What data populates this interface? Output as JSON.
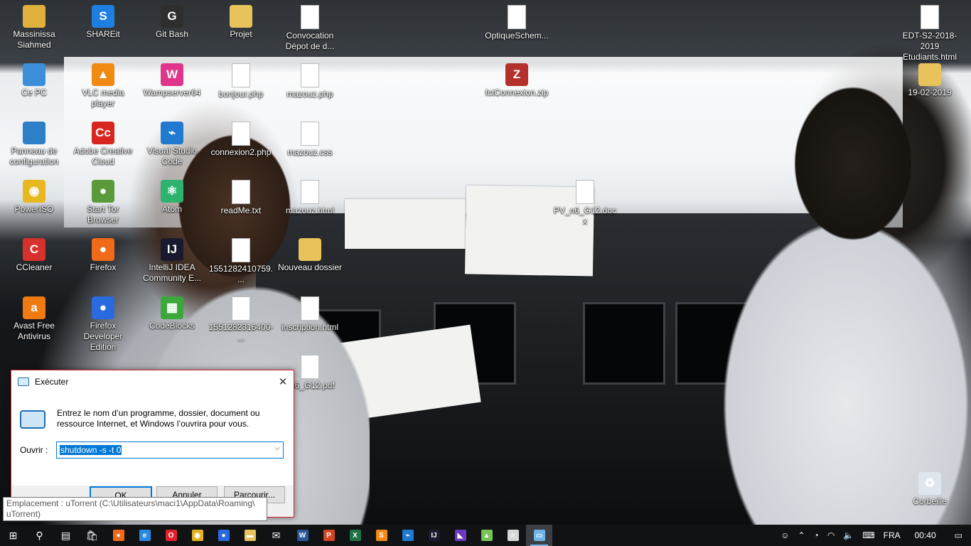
{
  "desktop_icons": [
    {
      "label": "Massinissa Siahmed",
      "col": 0,
      "row": 0,
      "icon": "user-folder-icon",
      "color": "#e0b03a",
      "glyph": "",
      "badge": "none"
    },
    {
      "label": "SHAREit",
      "col": 1,
      "row": 0,
      "icon": "shareit-icon",
      "color": "#1e7fe0",
      "glyph": "S",
      "badge": "arrow"
    },
    {
      "label": "Git Bash",
      "col": 2,
      "row": 0,
      "icon": "git-bash-icon",
      "color": "#2e2e2e",
      "glyph": "G",
      "badge": "arrow"
    },
    {
      "label": "Projet",
      "col": 3,
      "row": 0,
      "icon": "folder-icon",
      "color": "#e8c25a",
      "glyph": "",
      "badge": "sync"
    },
    {
      "label": "Convocation Dépot de d...",
      "col": 4,
      "row": 0,
      "icon": "document-icon",
      "color": "#ffffff",
      "glyph": "",
      "badge": "sync"
    },
    {
      "label": "OptiqueSchem...",
      "col": 7,
      "row": 0,
      "icon": "document-icon",
      "color": "#ffffff",
      "glyph": "",
      "badge": "sync"
    },
    {
      "label": "EDT-S2-2018-2019 Etudiants.html",
      "col": 13,
      "row": 0,
      "icon": "html-file-icon",
      "color": "#ffffff",
      "glyph": "",
      "badge": "sync"
    },
    {
      "label": "Ce PC",
      "col": 0,
      "row": 1,
      "icon": "computer-icon",
      "color": "#3a8fd8",
      "glyph": "",
      "badge": "none"
    },
    {
      "label": "VLC media player",
      "col": 1,
      "row": 1,
      "icon": "vlc-icon",
      "color": "#f08a12",
      "glyph": "▲",
      "badge": "arrow"
    },
    {
      "label": "Wampserver64",
      "col": 2,
      "row": 1,
      "icon": "wampserver-icon",
      "color": "#e0358a",
      "glyph": "W",
      "badge": "arrow"
    },
    {
      "label": "bonjour.php",
      "col": 3,
      "row": 1,
      "icon": "php-file-icon",
      "color": "#ffffff",
      "glyph": "",
      "badge": "sync"
    },
    {
      "label": "mazouz.php",
      "col": 4,
      "row": 1,
      "icon": "php-file-icon",
      "color": "#ffffff",
      "glyph": "",
      "badge": "sync"
    },
    {
      "label": "fctConnexion.zip",
      "col": 7,
      "row": 1,
      "icon": "zip-archive-icon",
      "color": "#b5302a",
      "glyph": "Z",
      "badge": "sync"
    },
    {
      "label": "19-02-2019",
      "col": 13,
      "row": 1,
      "icon": "folder-icon",
      "color": "#e8c25a",
      "glyph": "",
      "badge": "sync"
    },
    {
      "label": "Panneau de configuration",
      "col": 0,
      "row": 2,
      "icon": "control-panel-icon",
      "color": "#2d7fc8",
      "glyph": "",
      "badge": "none"
    },
    {
      "label": "Adobe Creative Cloud",
      "col": 1,
      "row": 2,
      "icon": "adobe-cc-icon",
      "color": "#d8251f",
      "glyph": "Cc",
      "badge": "arrow"
    },
    {
      "label": "Visual Studio Code",
      "col": 2,
      "row": 2,
      "icon": "vscode-icon",
      "color": "#1f7ad0",
      "glyph": "⌁",
      "badge": "arrow"
    },
    {
      "label": "connexion2.php",
      "col": 3,
      "row": 2,
      "icon": "php-file-icon",
      "color": "#ffffff",
      "glyph": "",
      "badge": "sync"
    },
    {
      "label": "mazouz.css",
      "col": 4,
      "row": 2,
      "icon": "css-file-icon",
      "color": "#ffffff",
      "glyph": "",
      "badge": "sync"
    },
    {
      "label": "PowerISO",
      "col": 0,
      "row": 3,
      "icon": "poweriso-icon",
      "color": "#e8b81e",
      "glyph": "◉",
      "badge": "arrow"
    },
    {
      "label": "Start Tor Browser",
      "col": 1,
      "row": 3,
      "icon": "tor-browser-icon",
      "color": "#5a9a3a",
      "glyph": "●",
      "badge": "arrow"
    },
    {
      "label": "Atom",
      "col": 2,
      "row": 3,
      "icon": "atom-icon",
      "color": "#2db36e",
      "glyph": "⚛",
      "badge": "arrow"
    },
    {
      "label": "readMe.txt",
      "col": 3,
      "row": 3,
      "icon": "text-file-icon",
      "color": "#ffffff",
      "glyph": "",
      "badge": "sync"
    },
    {
      "label": "mazouz.html",
      "col": 4,
      "row": 3,
      "icon": "html-file-icon",
      "color": "#ffffff",
      "glyph": "",
      "badge": "sync"
    },
    {
      "label": "PV_n6_G12.docx",
      "col": 8,
      "row": 3,
      "icon": "word-document-icon",
      "color": "#ffffff",
      "glyph": "",
      "badge": "sync"
    },
    {
      "label": "CCleaner",
      "col": 0,
      "row": 4,
      "icon": "ccleaner-icon",
      "color": "#d8302a",
      "glyph": "C",
      "badge": "arrow"
    },
    {
      "label": "Firefox",
      "col": 1,
      "row": 4,
      "icon": "firefox-icon",
      "color": "#f06a1a",
      "glyph": "●",
      "badge": "arrow"
    },
    {
      "label": "IntelliJ IDEA Community E...",
      "col": 2,
      "row": 4,
      "icon": "intellij-icon",
      "color": "#1a1a2e",
      "glyph": "IJ",
      "badge": "arrow"
    },
    {
      "label": "1551282410759....",
      "col": 3,
      "row": 4,
      "icon": "photo-file-icon",
      "color": "#8a9aa8",
      "glyph": "",
      "badge": "sync"
    },
    {
      "label": "Nouveau dossier",
      "col": 4,
      "row": 4,
      "icon": "folder-icon",
      "color": "#e8c25a",
      "glyph": "",
      "badge": "sync"
    },
    {
      "label": "Avast Free Antivirus",
      "col": 0,
      "row": 5,
      "icon": "avast-icon",
      "color": "#f07a12",
      "glyph": "a",
      "badge": "arrow"
    },
    {
      "label": "Firefox Developer Edition",
      "col": 1,
      "row": 5,
      "icon": "firefox-dev-icon",
      "color": "#2a6adf",
      "glyph": "●",
      "badge": "arrow"
    },
    {
      "label": "CodeBlocks",
      "col": 2,
      "row": 5,
      "icon": "codeblocks-icon",
      "color": "#3aa83a",
      "glyph": "▦",
      "badge": "arrow"
    },
    {
      "label": "1551282316400-...",
      "col": 3,
      "row": 5,
      "icon": "photo-file-icon",
      "color": "#8a9aa8",
      "glyph": "",
      "badge": "sync"
    },
    {
      "label": "inscription.html",
      "col": 4,
      "row": 5,
      "icon": "html-file-icon",
      "color": "#ffffff",
      "glyph": "",
      "badge": "sync"
    },
    {
      "label": "_n6_G12.pdf",
      "col": 4,
      "row": 6,
      "icon": "pdf-file-icon",
      "color": "#ffffff",
      "glyph": "",
      "badge": "sync"
    },
    {
      "label": "Corbeille",
      "col": 13,
      "row": 8,
      "icon": "recycle-bin-icon",
      "color": "#dfe6ee",
      "glyph": "♻",
      "badge": "none"
    }
  ],
  "run_dialog": {
    "title": "Exécuter",
    "description": "Entrez le nom d’un programme, dossier, document ou ressource Internet, et Windows l’ouvrira pour vous.",
    "open_label": "Ouvrir :",
    "command_value": "shutdown -s -t 0",
    "ok_label": "OK",
    "cancel_label": "Annuler",
    "browse_label": "Parcourir..."
  },
  "tooltip": {
    "text": "Emplacement : uTorrent (C:\\Utilisateurs\\maci1\\AppData\\Roaming\\ uTorrent)"
  },
  "taskbar": {
    "apps": [
      {
        "name": "windows-start-icon",
        "glyph": "⊞",
        "color": "#ffffff"
      },
      {
        "name": "search-icon",
        "glyph": "⚲",
        "color": "#ffffff"
      },
      {
        "name": "task-view-icon",
        "glyph": "▤",
        "color": "#ffffff"
      },
      {
        "name": "store-icon",
        "glyph": "🛍",
        "color": "#ffffff"
      },
      {
        "name": "firefox-icon",
        "glyph": "●",
        "color": "#f06a1a"
      },
      {
        "name": "edge-icon",
        "glyph": "e",
        "color": "#2a8ae0"
      },
      {
        "name": "opera-icon",
        "glyph": "O",
        "color": "#e0202a"
      },
      {
        "name": "chrome-icon",
        "glyph": "◉",
        "color": "#e2b022"
      },
      {
        "name": "firefox-dev-icon",
        "glyph": "●",
        "color": "#2a6adf"
      },
      {
        "name": "file-explorer-icon",
        "glyph": "▬",
        "color": "#e8c25a"
      },
      {
        "name": "mail-icon",
        "glyph": "✉",
        "color": "#ffffff"
      },
      {
        "name": "word-icon",
        "glyph": "W",
        "color": "#2b5797"
      },
      {
        "name": "powerpoint-icon",
        "glyph": "P",
        "color": "#d24726"
      },
      {
        "name": "excel-icon",
        "glyph": "X",
        "color": "#1e7145"
      },
      {
        "name": "sublime-text-icon",
        "glyph": "S",
        "color": "#f08a12"
      },
      {
        "name": "vscode-icon",
        "glyph": "⌁",
        "color": "#1f7ad0"
      },
      {
        "name": "intellij-icon",
        "glyph": "IJ",
        "color": "#1a1a2e"
      },
      {
        "name": "visual-studio-icon",
        "glyph": "◣",
        "color": "#6c3bbd"
      },
      {
        "name": "android-studio-icon",
        "glyph": "▲",
        "color": "#78c257"
      },
      {
        "name": "flag-app-icon",
        "glyph": "≡",
        "color": "#d8d8d8"
      },
      {
        "name": "run-dialog-icon",
        "glyph": "▭",
        "color": "#6fb3e8",
        "active": true
      }
    ],
    "tray": {
      "language": "FRA",
      "time": "00:40"
    }
  }
}
